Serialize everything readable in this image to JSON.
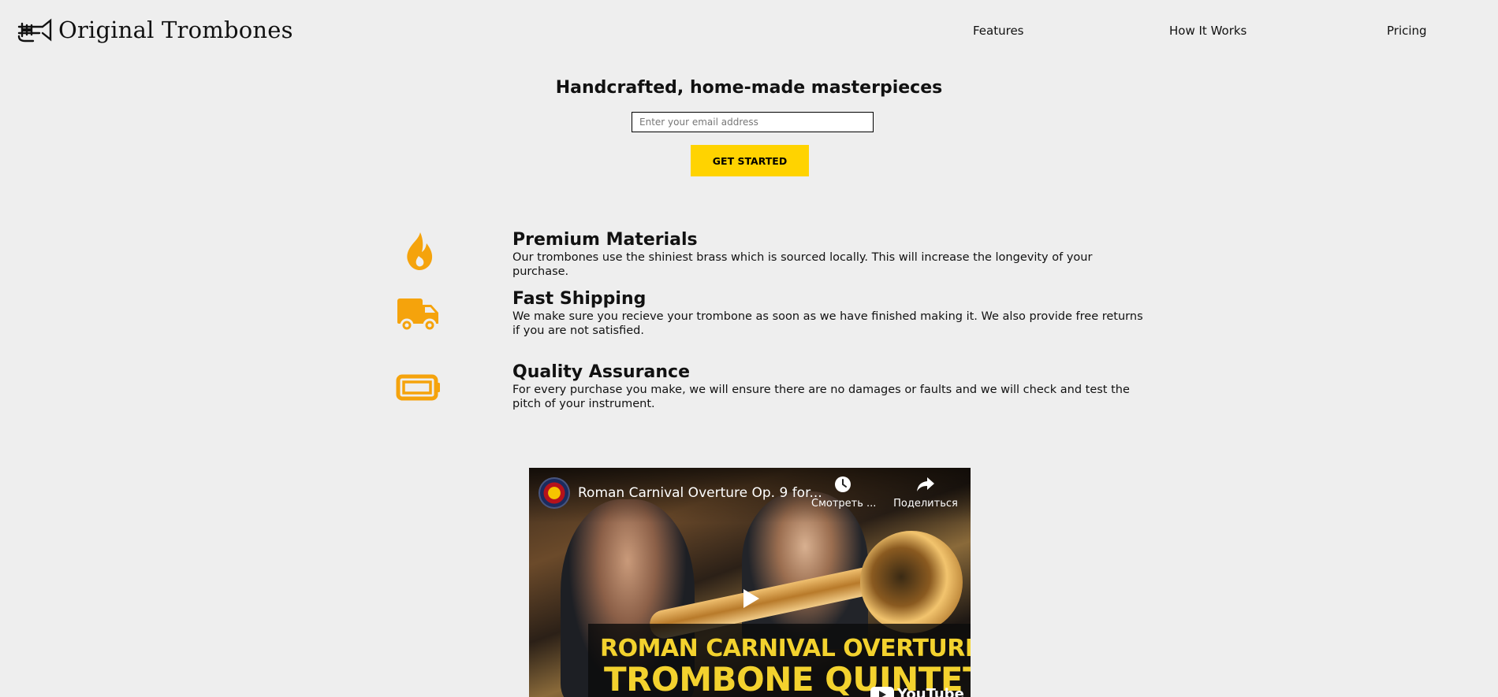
{
  "header": {
    "brand": "Original Trombones",
    "nav": [
      {
        "label": "Features"
      },
      {
        "label": "How It Works"
      },
      {
        "label": "Pricing"
      }
    ]
  },
  "hero": {
    "title": "Handcrafted, home-made masterpieces",
    "email_placeholder": "Enter your email address",
    "email_value": "",
    "cta_label": "GET STARTED"
  },
  "features": [
    {
      "icon": "fire-icon",
      "title": "Premium Materials",
      "description": "Our trombones use the shiniest brass which is sourced locally. This will increase the longevity of your purchase."
    },
    {
      "icon": "truck-icon",
      "title": "Fast Shipping",
      "description": "We make sure you recieve your trombone as soon as we have finished making it. We also provide free returns if you are not satisfied."
    },
    {
      "icon": "battery-icon",
      "title": "Quality Assurance",
      "description": "For every purchase you make, we will ensure there are no damages or faults and we will check and test the pitch of your instrument."
    }
  ],
  "video": {
    "title": "Roman Carnival Overture Op. 9 for...",
    "watch_later_label": "Смотреть ...",
    "share_label": "Поделиться",
    "banner_line1": "ROMAN CARNIVAL OVERTURE",
    "banner_line2": "TROMBONE QUINTET",
    "platform": "YouTube"
  },
  "colors": {
    "background": "#eeeeee",
    "accent": "#ffd300",
    "icon": "#f5a30c",
    "banner_text": "#f3d22e"
  }
}
